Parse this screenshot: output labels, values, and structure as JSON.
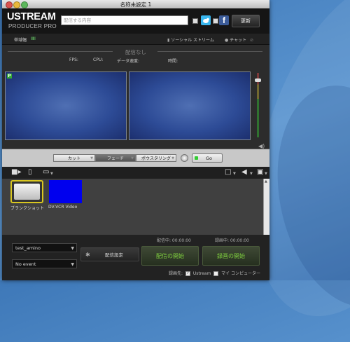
{
  "window": {
    "title": "名称未設定 1"
  },
  "header": {
    "logo_line1": "USTREAM",
    "logo_line2": "PRODUCER PRO",
    "search_placeholder": "配信する内容",
    "facebook_glyph": "f",
    "update_label": "更新"
  },
  "statusbar": {
    "bandwidth_label": "帯域幅",
    "bandwidth_bars": "IIIII",
    "social_stream_label": "ソーシャル ストリーム",
    "chat_label": "チャット"
  },
  "preview": {
    "status_text": "配信なし",
    "fps_label": "FPS:",
    "cpu_label": "CPU:",
    "datarate_label": "データ速度:",
    "time_label": "時間:",
    "badge": "P"
  },
  "switcher": {
    "cut_label": "カット",
    "fade_label": "フェード",
    "posturing_label": "ポウスタリング",
    "go_label": "Go"
  },
  "media": {
    "items": [
      {
        "label": "ブランクショット"
      },
      {
        "label": "DV-VCR Video"
      }
    ]
  },
  "bottom": {
    "show_select": "test_amino",
    "event_select": "No event",
    "settings_label": "配信設定",
    "broadcast_status": "配信中: 00:00:00",
    "record_status": "録画中: 00:00:00",
    "start_broadcast_label": "配信の開始",
    "start_record_label": "録画の開始",
    "record_dest_label": "録画先:",
    "dest_ustream": "Ustream",
    "dest_mycomputer": "マイ コンピューター"
  },
  "colors": {
    "accent_green": "#7fcf3f",
    "selected_border": "#d8c620",
    "preview_blue": "#2d4b96"
  },
  "icons": {
    "camera": "camera-plus-icon",
    "document": "add-file-icon",
    "monitor": "monitor-icon",
    "volume": "volume-icon",
    "headphones": "headphones-icon",
    "gear": "gear-icon"
  }
}
